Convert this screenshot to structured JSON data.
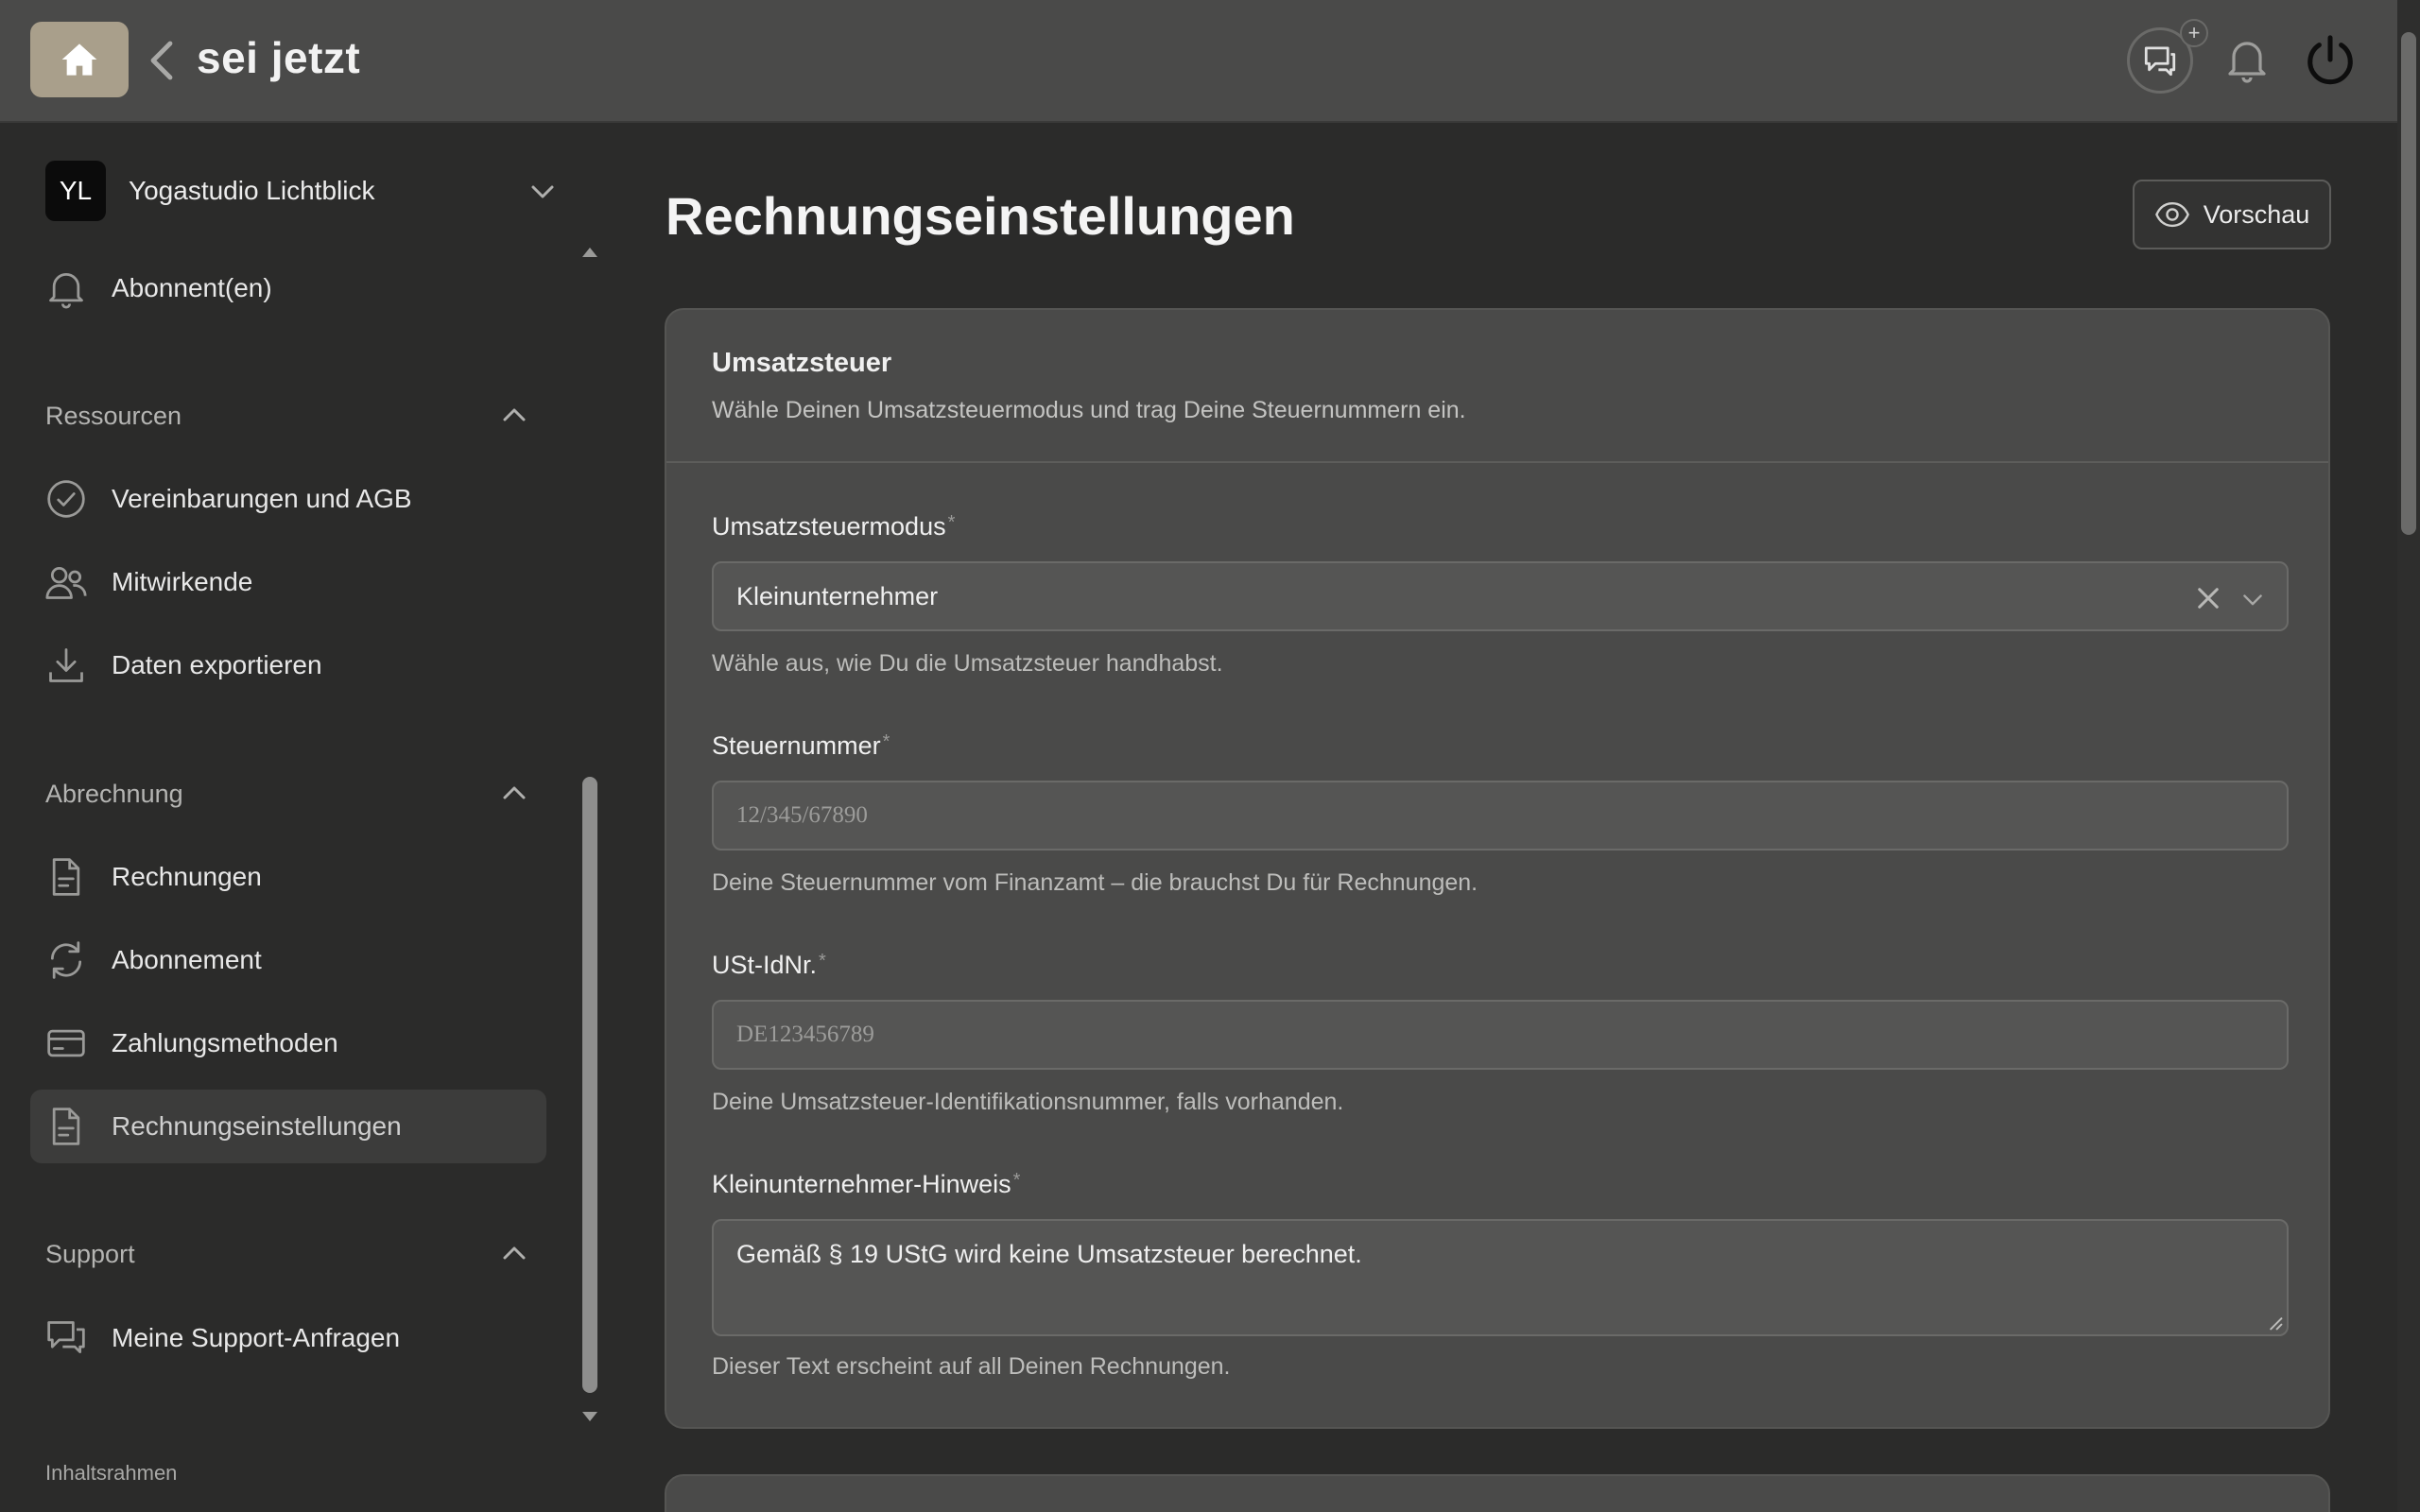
{
  "header": {
    "brand": "sei jetzt",
    "home_icon": "home-icon",
    "back_icon": "chevron-left-icon",
    "chat_icon": "chat-plus-icon",
    "chat_plus": "+",
    "bell_icon": "bell-icon",
    "power_icon": "power-icon"
  },
  "sidebar": {
    "org": {
      "initials": "YL",
      "name": "Yogastudio Lichtblick"
    },
    "top_items": [
      {
        "label": "Abonnent(en)",
        "icon": "bell-icon"
      }
    ],
    "sections": [
      {
        "label": "Ressourcen",
        "expanded": true,
        "items": [
          {
            "label": "Vereinbarungen und AGB",
            "icon": "check-circle-icon"
          },
          {
            "label": "Mitwirkende",
            "icon": "users-icon"
          },
          {
            "label": "Daten exportieren",
            "icon": "download-icon"
          }
        ]
      },
      {
        "label": "Abrechnung",
        "expanded": true,
        "items": [
          {
            "label": "Rechnungen",
            "icon": "document-icon"
          },
          {
            "label": "Abonnement",
            "icon": "refresh-icon"
          },
          {
            "label": "Zahlungsmethoden",
            "icon": "credit-card-icon"
          },
          {
            "label": "Rechnungseinstellungen",
            "icon": "document-icon",
            "active": true
          }
        ]
      },
      {
        "label": "Support",
        "expanded": true,
        "items": [
          {
            "label": "Meine Support-Anfragen",
            "icon": "chat-icon"
          }
        ]
      }
    ],
    "footer": "Inhaltsrahmen"
  },
  "main": {
    "title": "Rechnungseinstellungen",
    "preview_button": "Vorschau",
    "card": {
      "title": "Umsatzsteuer",
      "description": "Wähle Deinen Umsatzsteuermodus und trag Deine Steuernummern ein.",
      "fields": {
        "vat_mode": {
          "label": "Umsatzsteuermodus",
          "required": "*",
          "value": "Kleinunternehmer",
          "help": "Wähle aus, wie Du die Umsatzsteuer handhabst."
        },
        "tax_number": {
          "label": "Steuernummer",
          "required": "*",
          "placeholder": "12/345/67890",
          "help": "Deine Steuernummer vom Finanzamt – die brauchst Du für Rechnungen."
        },
        "vat_id": {
          "label": "USt-IdNr.",
          "required": "*",
          "placeholder": "DE123456789",
          "help": "Deine Umsatzsteuer-Identifikationsnummer, falls vorhanden."
        },
        "small_business_note": {
          "label": "Kleinunternehmer-Hinweis",
          "required": "*",
          "value": "Gemäß § 19 UStG wird keine Umsatzsteuer berechnet.",
          "help": "Dieser Text erscheint auf all Deinen Rechnungen."
        }
      }
    }
  },
  "colors": {
    "background": "#2b2b2a",
    "topbar": "#4a4a49",
    "home_button": "#a99f8b",
    "card": "#4a4a49",
    "input": "#555554",
    "active_nav": "#3c3c3b"
  }
}
